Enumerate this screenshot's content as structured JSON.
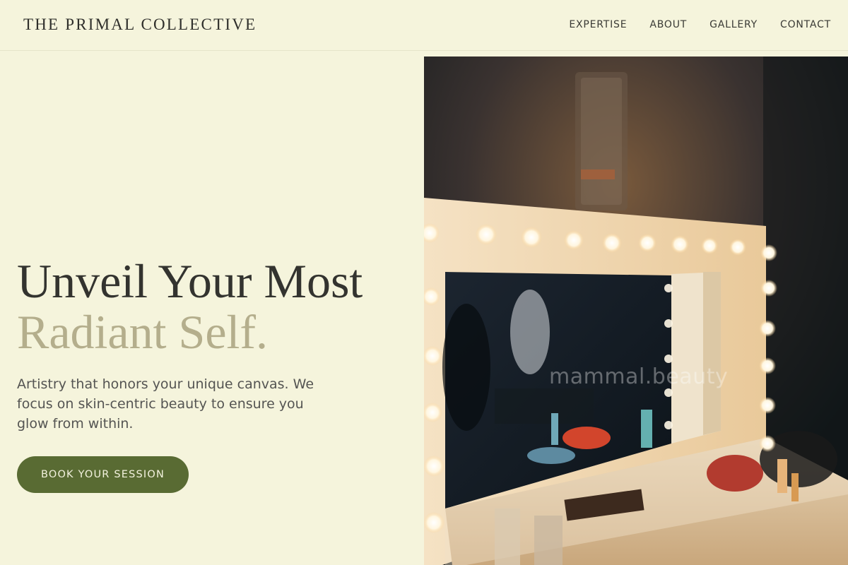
{
  "header": {
    "brand": "THE PRIMAL COLLECTIVE",
    "nav": [
      {
        "label": "EXPERTISE"
      },
      {
        "label": "ABOUT"
      },
      {
        "label": "GALLERY"
      },
      {
        "label": "CONTACT"
      }
    ]
  },
  "hero": {
    "title_line1": "Unveil Your Most",
    "title_line2": "Radiant Self.",
    "description": "Artistry that honors your unique canvas. We focus on skin-centric beauty to ensure you glow from within.",
    "cta_label": "BOOK YOUR SESSION"
  },
  "photo": {
    "subject": "vanity-mirror-with-bulbs",
    "watermark": "mammal.beauty"
  },
  "colors": {
    "background": "#f5f4dc",
    "accent_green": "#596b33",
    "title_dark": "#33332f",
    "title_muted": "#b4ae8c"
  }
}
